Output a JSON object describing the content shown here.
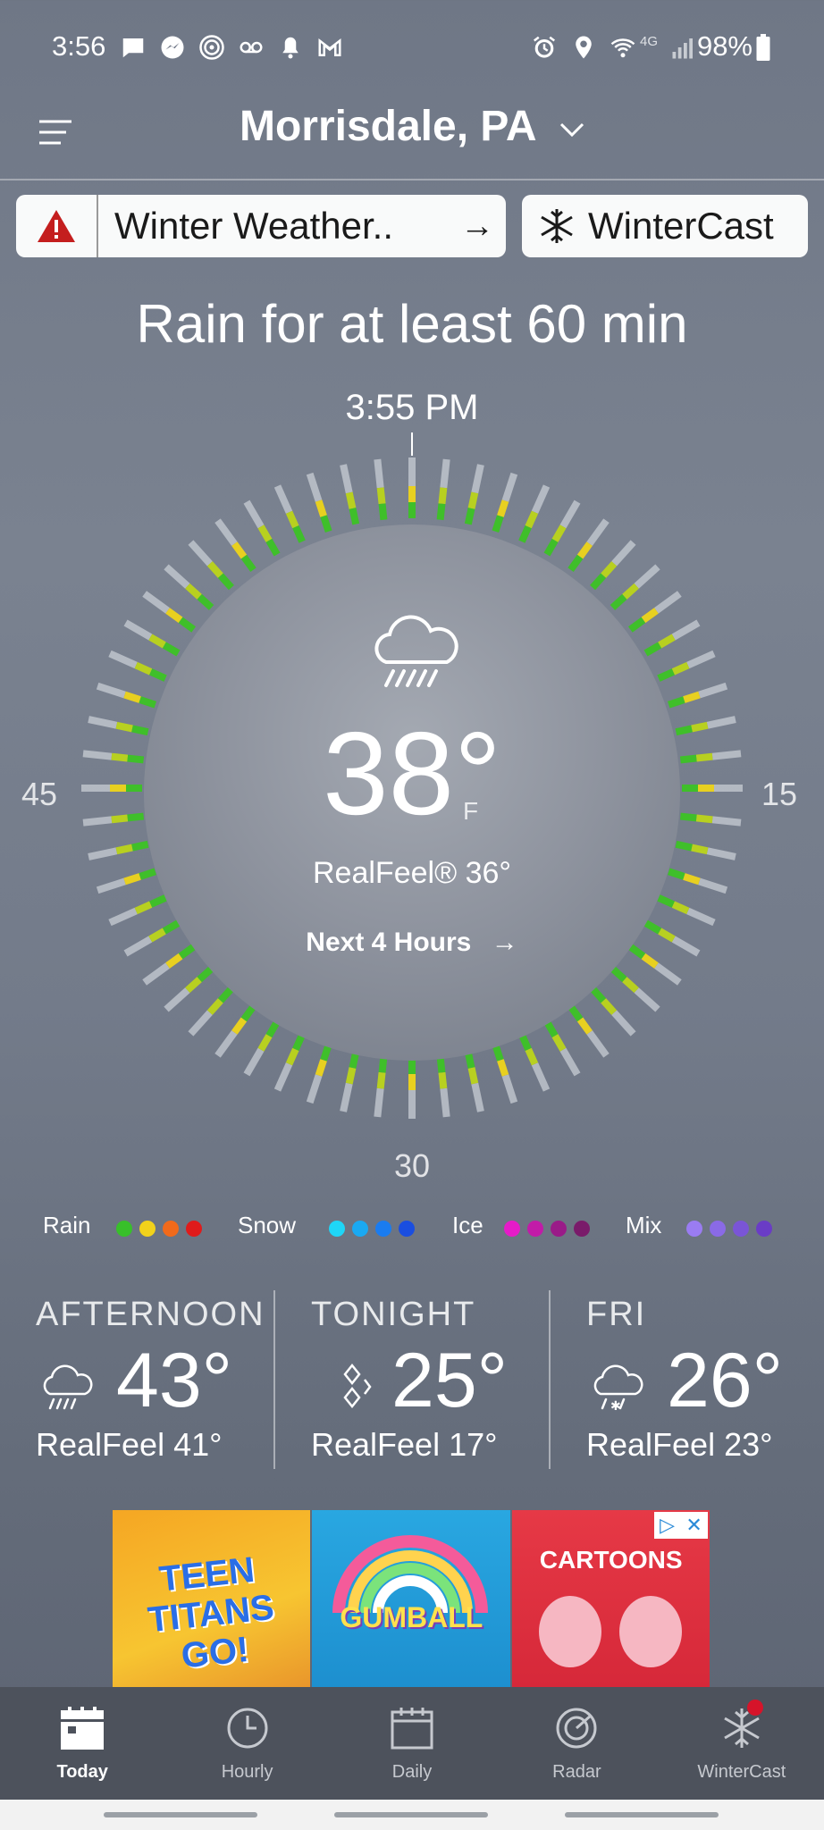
{
  "status_bar": {
    "time": "3:56",
    "network": "4G",
    "battery": "98%",
    "icons": [
      "message-icon",
      "messenger-icon",
      "pocket-icon",
      "voicemail-icon",
      "bell-icon",
      "gmail-icon",
      "alarm-icon",
      "location-icon",
      "wifi-icon",
      "signal-icon",
      "battery-icon"
    ]
  },
  "header": {
    "location": "Morrisdale, PA"
  },
  "alert": {
    "label": "Winter Weather..",
    "icon_color": "#c41e1e"
  },
  "wintercast_chip": {
    "label": "WinterCast"
  },
  "minutecast": {
    "headline": "Rain for at least 60 min",
    "time": "3:55 PM",
    "label_left": "45",
    "label_right": "15",
    "label_bottom": "30"
  },
  "current": {
    "condition_icon": "rain-cloud-icon",
    "temperature": "38°",
    "unit": "F",
    "realfeel": "RealFeel® 36°",
    "next_hours": "Next 4 Hours"
  },
  "legend": {
    "rain": {
      "label": "Rain",
      "colors": [
        "#38c02a",
        "#f2d21b",
        "#f26a1b",
        "#e01b1b"
      ]
    },
    "snow": {
      "label": "Snow",
      "colors": [
        "#1ed6f7",
        "#1aa9f2",
        "#1a7cf0",
        "#1a4ee0"
      ]
    },
    "ice": {
      "label": "Ice",
      "colors": [
        "#e61bc8",
        "#c21ba8",
        "#9a1b88",
        "#7a1b6a"
      ]
    },
    "mix": {
      "label": "Mix",
      "colors": [
        "#9a7cf2",
        "#8a6ae6",
        "#7a55d6",
        "#6a3cc6"
      ]
    }
  },
  "forecast": [
    {
      "label": "AFTERNOON",
      "temp": "43°",
      "realfeel": "RealFeel 41°",
      "icon": "rain-cloud-icon"
    },
    {
      "label": "TONIGHT",
      "temp": "25°",
      "realfeel": "RealFeel 17°",
      "icon": "sleet-icon"
    },
    {
      "label": "FRI",
      "temp": "26°",
      "realfeel": "RealFeel 23°",
      "icon": "snow-rain-icon"
    }
  ],
  "ad": {
    "panels": [
      "TEEN TITANS GO!",
      "GUMBALL",
      "CARTOONS"
    ]
  },
  "nav": {
    "items": [
      {
        "label": "Today",
        "icon": "calendar-today-icon"
      },
      {
        "label": "Hourly",
        "icon": "clock-icon"
      },
      {
        "label": "Daily",
        "icon": "calendar-icon"
      },
      {
        "label": "Radar",
        "icon": "radar-icon"
      },
      {
        "label": "WinterCast",
        "icon": "snowflake-icon"
      }
    ]
  }
}
